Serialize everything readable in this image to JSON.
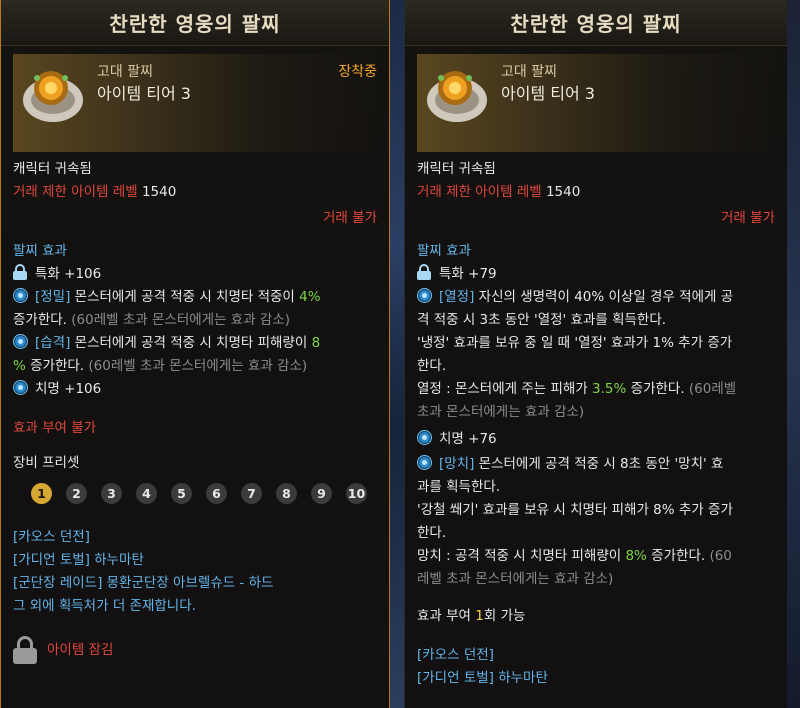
{
  "left": {
    "title": "찬란한 영웅의 팔찌",
    "grade": "고대 팔찌",
    "tier": "아이템 티어 3",
    "equipped": "장착중",
    "bound": "캐릭터 귀속됨",
    "trade_level_label": "거래 제한 아이템 레벨",
    "trade_level_value": "1540",
    "no_trade": "거래 불가",
    "effect_header": "팔찌 효과",
    "stat1": "특화 +106",
    "eff1_tag": "[정밀]",
    "eff1_text_a": " 몬스터에게 공격 적중 시 치명타 적중이 ",
    "eff1_value": "4%",
    "eff1_text_b": "증가한다.",
    "eff1_note": " (60레벨 초과 몬스터에게는 효과 감소)",
    "eff2_tag": "[습격]",
    "eff2_text_a": " 몬스터에게 공격 적중 시 치명타 피해량이 ",
    "eff2_value_a": "8",
    "eff2_value_b": "%",
    "eff2_text_b": " 증가한다.",
    "eff2_note": " (60레벨 초과 몬스터에게는 효과 감소)",
    "stat2": "치명 +106",
    "no_grant": "효과 부여 불가",
    "preset_label": "장비 프리셋",
    "presets": [
      "1",
      "2",
      "3",
      "4",
      "5",
      "6",
      "7",
      "8",
      "9",
      "10"
    ],
    "sources": [
      "[카오스 던전]",
      "[가디언 토벌] 하누마탄",
      "[군단장 레이드] 몽환군단장 아브렐슈드 - 하드",
      "그 외에 획득처가 더 존재합니다."
    ],
    "locked": "아이템 잠김"
  },
  "right": {
    "title": "찬란한 영웅의 팔찌",
    "grade": "고대 팔찌",
    "tier": "아이템 티어 3",
    "bound": "캐릭터 귀속됨",
    "trade_level_label": "거래 제한 아이템 레벨",
    "trade_level_value": "1540",
    "no_trade": "거래 불가",
    "effect_header": "팔찌 효과",
    "stat1": "특화 +79",
    "eff1_tag": "[열정]",
    "eff1_line1": " 자신의 생명력이 40% 이상일 경우 적에게 공",
    "eff1_line2": "격 적중 시 3초 동안 '열정' 효과를 획득한다.",
    "eff1_line3": "'냉정' 효과를 보유 중 일 때 '열정' 효과가 1% 추가 증가",
    "eff1_line4": "한다.",
    "eff1_detail_a": "열정 : 몬스터에게 주는 피해가 ",
    "eff1_value": "3.5%",
    "eff1_detail_b": " 증가한다.",
    "eff1_note_a": " (60레벨",
    "eff1_note_b": "초과 몬스터에게는 효과 감소)",
    "stat2": "치명 +76",
    "eff2_tag": "[망치]",
    "eff2_line1": " 몬스터에게 공격 적중 시 8초 동안 '망치' 효",
    "eff2_line2": "과를 획득한다.",
    "eff2_line3": "'강철 쐐기' 효과를 보유 시 치명타 피해가 8% 추가 증가",
    "eff2_line4": "한다.",
    "eff2_detail_a": "망치 : 공격 적중 시 치명타 피해량이 ",
    "eff2_value": "8%",
    "eff2_detail_b": " 증가한다.",
    "eff2_note_a": " (60",
    "eff2_note_b": "레벨 초과 몬스터에게는 효과 감소)",
    "grant_a": "효과 부여 ",
    "grant_count": "1",
    "grant_b": "회 가능",
    "sources": [
      "[카오스 던전]",
      "[가디언 토벌] 하누마탄"
    ]
  }
}
